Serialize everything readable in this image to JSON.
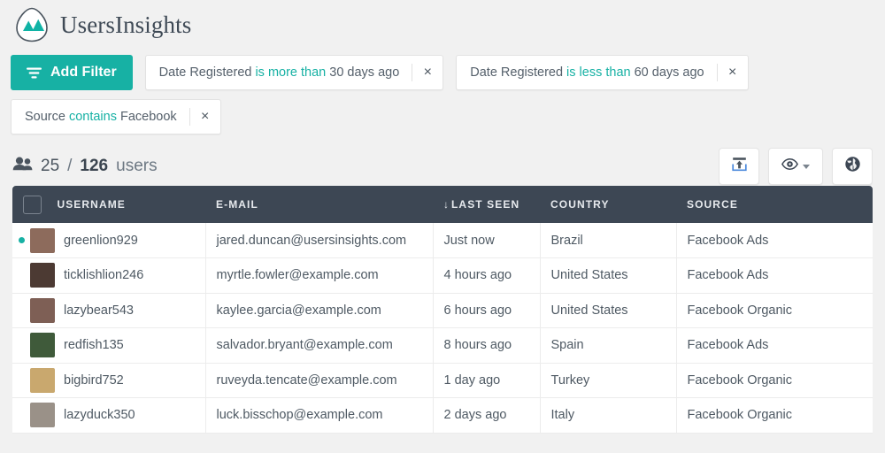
{
  "brand": {
    "name": "UsersInsights",
    "accent": "#17b1a4",
    "dark": "#3d4754"
  },
  "toolbar": {
    "add_filter_label": "Add Filter",
    "filters": [
      {
        "field": "Date Registered",
        "operator": "is more than",
        "value": "30 days ago",
        "close": "×"
      },
      {
        "field": "Date Registered",
        "operator": "is less than",
        "value": "60 days ago",
        "close": "×"
      },
      {
        "field": "Source",
        "operator": "contains",
        "value": "Facebook",
        "close": "×"
      }
    ]
  },
  "summary": {
    "shown": "25",
    "separator": "/",
    "total": "126",
    "unit": "users"
  },
  "actions": [
    {
      "name": "export-button",
      "icon": "export-icon"
    },
    {
      "name": "visible-columns-button",
      "icon": "eye-icon"
    },
    {
      "name": "map-view-button",
      "icon": "globe-icon"
    }
  ],
  "table": {
    "columns": [
      {
        "key": "username",
        "label": "USERNAME",
        "sorted": false
      },
      {
        "key": "email",
        "label": "E-MAIL",
        "sorted": false
      },
      {
        "key": "last_seen",
        "label": "LAST SEEN",
        "sorted": true,
        "sort_arrow": "↓"
      },
      {
        "key": "country",
        "label": "COUNTRY",
        "sorted": false
      },
      {
        "key": "source",
        "label": "SOURCE",
        "sorted": false
      }
    ],
    "rows": [
      {
        "online": true,
        "username": "greenlion929",
        "email": "jared.duncan@usersinsights.com",
        "last_seen": "Just now",
        "country": "Brazil",
        "source": "Facebook Ads",
        "avatar": "#8d6b5c"
      },
      {
        "online": false,
        "username": "ticklishlion246",
        "email": "myrtle.fowler@example.com",
        "last_seen": "4 hours ago",
        "country": "United States",
        "source": "Facebook Ads",
        "avatar": "#4c3a33"
      },
      {
        "online": false,
        "username": "lazybear543",
        "email": "kaylee.garcia@example.com",
        "last_seen": "6 hours ago",
        "country": "United States",
        "source": "Facebook Organic",
        "avatar": "#7e5f55"
      },
      {
        "online": false,
        "username": "redfish135",
        "email": "salvador.bryant@example.com",
        "last_seen": "8 hours ago",
        "country": "Spain",
        "source": "Facebook Ads",
        "avatar": "#3f5a3a"
      },
      {
        "online": false,
        "username": "bigbird752",
        "email": "ruveyda.tencate@example.com",
        "last_seen": "1 day ago",
        "country": "Turkey",
        "source": "Facebook Organic",
        "avatar": "#c9a86e"
      },
      {
        "online": false,
        "username": "lazyduck350",
        "email": "luck.bisschop@example.com",
        "last_seen": "2 days ago",
        "country": "Italy",
        "source": "Facebook Organic",
        "avatar": "#9a9188"
      }
    ]
  }
}
